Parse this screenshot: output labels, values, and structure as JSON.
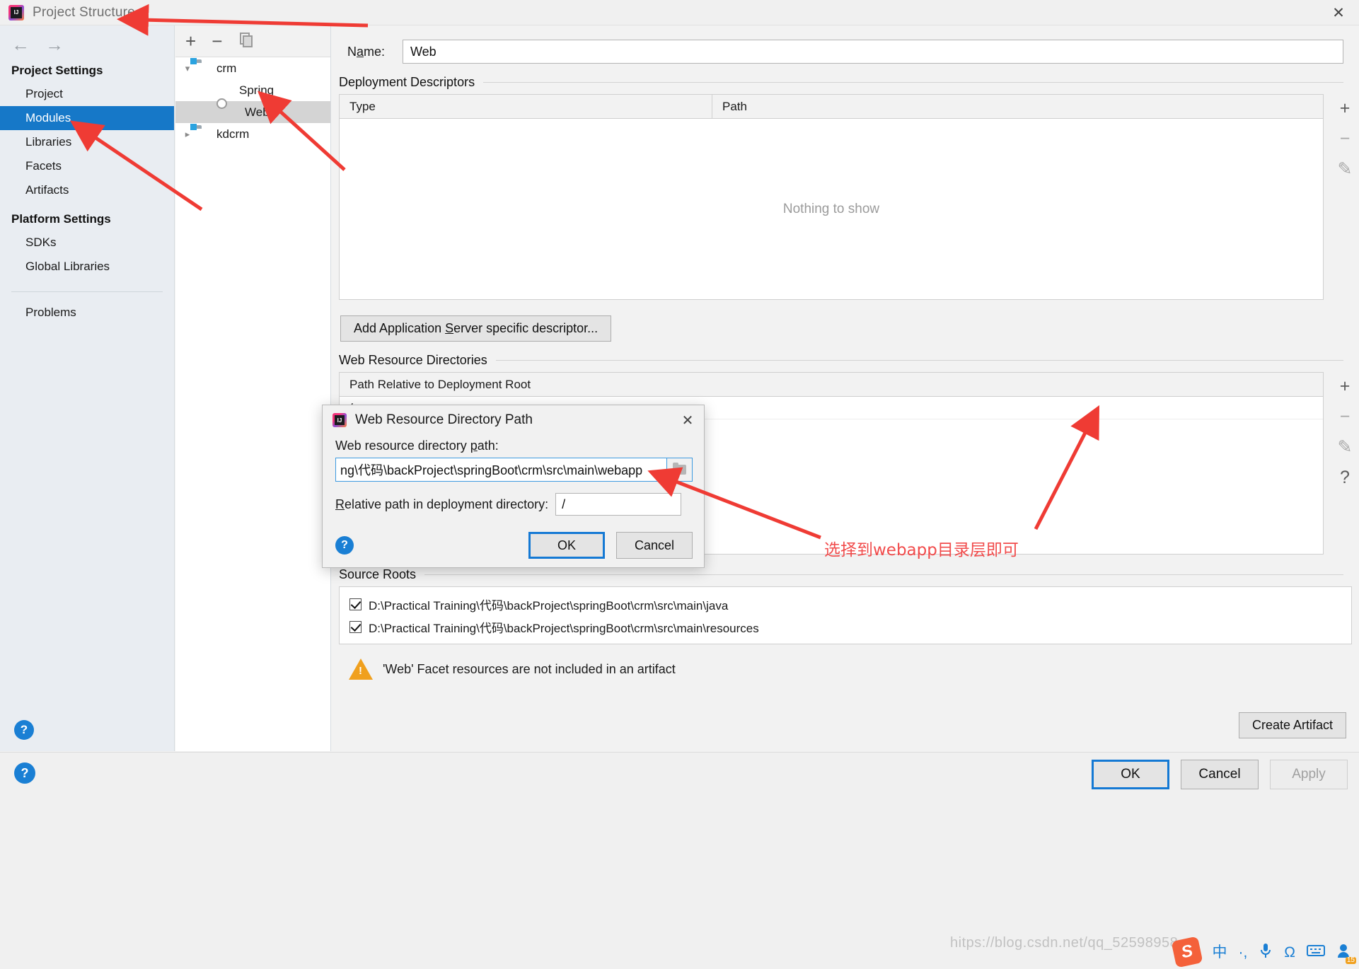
{
  "window": {
    "title": "Project Structure",
    "close_label": "✕",
    "logo_icon": "intellij-idea-logo"
  },
  "sidebar": {
    "back_icon": "arrow-left-icon",
    "forward_icon": "arrow-right-icon",
    "groups": [
      {
        "title": "Project Settings",
        "items": [
          {
            "label": "Project",
            "selected": false
          },
          {
            "label": "Modules",
            "selected": true
          },
          {
            "label": "Libraries",
            "selected": false
          },
          {
            "label": "Facets",
            "selected": false
          },
          {
            "label": "Artifacts",
            "selected": false
          }
        ]
      },
      {
        "title": "Platform Settings",
        "items": [
          {
            "label": "SDKs",
            "selected": false
          },
          {
            "label": "Global Libraries",
            "selected": false
          }
        ]
      }
    ],
    "problems_label": "Problems",
    "help_label": "?"
  },
  "tree": {
    "toolbar": {
      "add_label": "+",
      "remove_label": "−",
      "copy_icon": "copy-icon"
    },
    "nodes": [
      {
        "label": "crm",
        "icon": "folder-module-icon",
        "twisty": "▾",
        "depth": 0,
        "selected": false
      },
      {
        "label": "Spring",
        "icon": "spring-facet-icon",
        "twisty": "",
        "depth": 1,
        "selected": false
      },
      {
        "label": "Web",
        "icon": "web-facet-icon",
        "twisty": "",
        "depth": 1,
        "selected": true
      },
      {
        "label": "kdcrm",
        "icon": "folder-module-icon",
        "twisty": "▸",
        "depth": 0,
        "selected": false
      }
    ]
  },
  "detail": {
    "name_label": "Name:",
    "name_value": "Web",
    "deployment": {
      "section_title": "Deployment Descriptors",
      "columns": [
        "Type",
        "Path"
      ],
      "empty_text": "Nothing to show",
      "tools": [
        "+",
        "−",
        "✎"
      ],
      "add_descriptor_button": "Add Application Server specific descriptor..."
    },
    "web_resources": {
      "section_title": "Web Resource Directories",
      "column_header": "Path Relative to Deployment Root",
      "rows": [
        "/"
      ],
      "tools": [
        "+",
        "−",
        "✎",
        "?"
      ]
    },
    "source_roots": {
      "section_title": "Source Roots",
      "rows": [
        {
          "checked": true,
          "path": "D:\\Practical Training\\代码\\backProject\\springBoot\\crm\\src\\main\\java"
        },
        {
          "checked": true,
          "path": "D:\\Practical Training\\代码\\backProject\\springBoot\\crm\\src\\main\\resources"
        }
      ]
    },
    "warning": {
      "icon": "warning-triangle-icon",
      "text": "'Web' Facet resources are not included in an artifact"
    },
    "create_artifact_button": "Create Artifact"
  },
  "bottom": {
    "help_label": "?",
    "ok_label": "OK",
    "cancel_label": "Cancel",
    "apply_label": "Apply"
  },
  "modal": {
    "title": "Web Resource Directory Path",
    "logo_icon": "intellij-idea-logo",
    "close_label": "✕",
    "path_label_pre": "Web resource directory ",
    "path_label_mnemonic": "p",
    "path_label_post": "ath:",
    "path_value": "ng\\代码\\backProject\\springBoot\\crm\\src\\main\\webapp",
    "browse_icon": "folder-browse-icon",
    "relative_label_mnemonic": "R",
    "relative_label_post": "elative path in deployment directory:",
    "relative_value": "/",
    "help_label": "?",
    "ok_label": "OK",
    "cancel_label": "Cancel"
  },
  "annotations": {
    "note_text": "选择到webapp目录层即可",
    "color": "#f14b4b"
  },
  "taskbar": {
    "sogou_icon": "sogou-logo-icon",
    "items": [
      "中",
      "·,",
      "mic-icon",
      "Ω",
      "keyboard-icon",
      "user-icon"
    ],
    "badge": "15"
  },
  "watermark": "hitps://blog.csdn.net/qq_52598958"
}
